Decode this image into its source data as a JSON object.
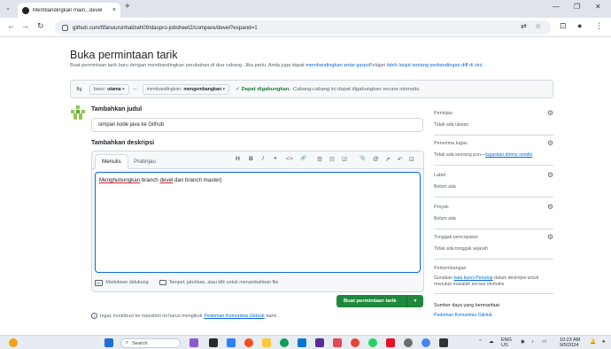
{
  "browser": {
    "tab_title": "Membandingkan main...devel",
    "tab_close": "×",
    "new_tab": "+",
    "tab_menu": "⌄",
    "url": "github.com/fifanuurunhalizah09/daspro-jobsheet2/compare/devel?expand=1",
    "win_min": "—",
    "win_restore": "❐",
    "win_close": "✕"
  },
  "page": {
    "title": "Buka permintaan tarik",
    "subtitle_prefix": "Buat permintaan tarik baru dengan membandingkan perubahan di dua cabang. Jika perlu, Anda juga dapat ",
    "subtitle_link1": "membandingkan antar garpu",
    "subtitle_mid": "Pelajari ",
    "subtitle_link2": "lebih lanjut tentang perbandingan diff di sini",
    "subtitle_end": " ."
  },
  "compare": {
    "base_label": "basis:",
    "base_branch": "utama",
    "arrow": "←",
    "compare_label": "membandingkan:",
    "compare_branch": "mengembangkan",
    "status_ok": "✓ Dapat digabungkan.",
    "status_rest": "Cabang-cabang ini dapat digabungkan secara otomatis."
  },
  "form": {
    "title_heading": "Tambahkan judul",
    "title_value": "simpan kode java ke Github",
    "desc_heading": "Tambahkan deskripsi",
    "tab_write": "Menulis",
    "tab_preview": "Pratinjau",
    "desc_word1": "Menghubungkan",
    "desc_mid": " branch ",
    "desc_word2": "devel",
    "desc_end": " dan branch master",
    "markdown_note": "Markdown didukung",
    "paste_note": "Tempel, jatuhkan, atau klik untuk menambahkan file",
    "create_button": "Buat permintaan tarik",
    "caret": "▼"
  },
  "toolbar": {
    "heading": "H",
    "bold": "B",
    "italic": "I",
    "quote": "❝",
    "code": "<>",
    "link": "🔗",
    "ul": "☰",
    "ol": "☷",
    "task": "☑",
    "mention_file": "📎",
    "mention": "@",
    "ref": "↗",
    "undo": "↶",
    "fullscreen": "⊡"
  },
  "footnote": {
    "prefix": "Ingat, kontribusi ke repositori ini harus mengikuti ",
    "link": "Pedoman Komunitas GitHub",
    "suffix": " kami ."
  },
  "sidebar": {
    "reviewers": "Peninjau",
    "reviewers_value": "Tidak ada ulasan",
    "assignees": "Penerima tugas",
    "assignees_prefix": "Tidak ada seorang pun—",
    "assignees_link": "tugaskan dirimu sendiri",
    "labels": "Label",
    "labels_value": "Belum ada",
    "projects": "Proyek",
    "projects_value": "Belum ada",
    "milestone": "Tonggak pencapaian",
    "milestone_value": "Tidak ada tonggak sejarah",
    "development": "Perkembangan",
    "development_prefix": "Gunakan ",
    "development_link": "kata kunci Penutup",
    "development_suffix": " dalam deskripsi untuk menutup masalah secara otomatis",
    "resources": "Sumber daya yang bermanfaat",
    "resources_link": "Pedoman Komunitas GitHub"
  },
  "taskbar": {
    "search": "Search",
    "lang1": "ENG",
    "lang2": "US",
    "time": "10:23 AM",
    "date": "9/5/2024"
  },
  "colors": {
    "accent": "#0969da",
    "success": "#1a7f37",
    "button": "#1f883d"
  }
}
